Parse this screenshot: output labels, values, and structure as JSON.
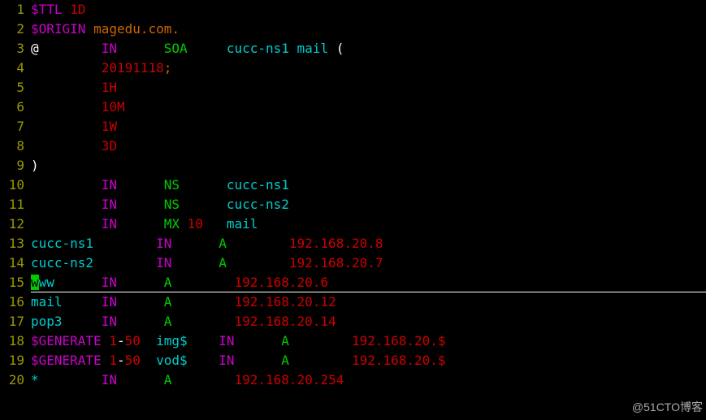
{
  "lines": [
    {
      "n": "1",
      "tokens": [
        [
          "purple",
          "$TTL "
        ],
        [
          "darkred",
          "1D"
        ]
      ]
    },
    {
      "n": "2",
      "tokens": [
        [
          "purple",
          "$ORIGIN "
        ],
        [
          "orange",
          "magedu.com."
        ]
      ]
    },
    {
      "n": "3",
      "tokens": [
        [
          "white",
          "@        "
        ],
        [
          "purple",
          "IN      "
        ],
        [
          "green",
          "SOA     "
        ],
        [
          "cyan",
          "cucc-ns1 mail"
        ],
        [
          "white",
          " ("
        ]
      ]
    },
    {
      "n": "4",
      "tokens": [
        [
          "white",
          "         "
        ],
        [
          "darkred",
          "20191118"
        ],
        [
          "orange",
          ";"
        ]
      ]
    },
    {
      "n": "5",
      "tokens": [
        [
          "white",
          "         "
        ],
        [
          "darkred",
          "1H"
        ]
      ]
    },
    {
      "n": "6",
      "tokens": [
        [
          "white",
          "         "
        ],
        [
          "darkred",
          "10M"
        ]
      ]
    },
    {
      "n": "7",
      "tokens": [
        [
          "white",
          "         "
        ],
        [
          "darkred",
          "1W"
        ]
      ]
    },
    {
      "n": "8",
      "tokens": [
        [
          "white",
          "         "
        ],
        [
          "darkred",
          "3D"
        ]
      ]
    },
    {
      "n": "9",
      "tokens": [
        [
          "white",
          ")"
        ]
      ]
    },
    {
      "n": "10",
      "tokens": [
        [
          "white",
          "         "
        ],
        [
          "purple",
          "IN      "
        ],
        [
          "green",
          "NS      "
        ],
        [
          "cyan",
          "cucc-ns1"
        ]
      ]
    },
    {
      "n": "11",
      "tokens": [
        [
          "white",
          "         "
        ],
        [
          "purple",
          "IN      "
        ],
        [
          "green",
          "NS      "
        ],
        [
          "cyan",
          "cucc-ns2"
        ]
      ]
    },
    {
      "n": "12",
      "tokens": [
        [
          "white",
          "         "
        ],
        [
          "purple",
          "IN      "
        ],
        [
          "green",
          "MX "
        ],
        [
          "darkred",
          "10   "
        ],
        [
          "cyan",
          "mail"
        ]
      ]
    },
    {
      "n": "13",
      "tokens": [
        [
          "cyan",
          "cucc-ns1        "
        ],
        [
          "purple",
          "IN      "
        ],
        [
          "green",
          "A        "
        ],
        [
          "darkred",
          "192.168.20.8"
        ]
      ]
    },
    {
      "n": "14",
      "tokens": [
        [
          "cyan",
          "cucc-ns2        "
        ],
        [
          "purple",
          "IN      "
        ],
        [
          "green",
          "A        "
        ],
        [
          "darkred",
          "192.168.20.7"
        ]
      ]
    },
    {
      "n": "16",
      "tokens": [
        [
          "cyan",
          "mail     "
        ],
        [
          "purple",
          "IN      "
        ],
        [
          "green",
          "A        "
        ],
        [
          "darkred",
          "192.168.20.12"
        ]
      ]
    },
    {
      "n": "17",
      "tokens": [
        [
          "cyan",
          "pop3     "
        ],
        [
          "purple",
          "IN      "
        ],
        [
          "green",
          "A        "
        ],
        [
          "darkred",
          "192.168.20.14"
        ]
      ]
    },
    {
      "n": "18",
      "tokens": [
        [
          "purple",
          "$GENERATE "
        ],
        [
          "darkred",
          "1"
        ],
        [
          "white",
          "-"
        ],
        [
          "darkred",
          "50  "
        ],
        [
          "cyan",
          "img$    "
        ],
        [
          "purple",
          "IN      "
        ],
        [
          "green",
          "A        "
        ],
        [
          "darkred",
          "192.168.20.$"
        ]
      ]
    },
    {
      "n": "19",
      "tokens": [
        [
          "purple",
          "$GENERATE "
        ],
        [
          "darkred",
          "1"
        ],
        [
          "white",
          "-"
        ],
        [
          "darkred",
          "50  "
        ],
        [
          "cyan",
          "vod$    "
        ],
        [
          "purple",
          "IN      "
        ],
        [
          "green",
          "A        "
        ],
        [
          "darkred",
          "192.168.20.$"
        ]
      ]
    },
    {
      "n": "20",
      "tokens": [
        [
          "cyan",
          "*        "
        ],
        [
          "purple",
          "IN      "
        ],
        [
          "green",
          "A        "
        ],
        [
          "darkred",
          "192.168.20.254"
        ]
      ]
    }
  ],
  "cursorLine": {
    "n": "15",
    "cursor_char": "w",
    "tokens": [
      [
        "cyan",
        "ww      "
      ],
      [
        "purple",
        "IN      "
      ],
      [
        "green",
        "A        "
      ],
      [
        "darkred",
        "192.168.20.6"
      ]
    ]
  },
  "watermark": "@51CTO博客"
}
